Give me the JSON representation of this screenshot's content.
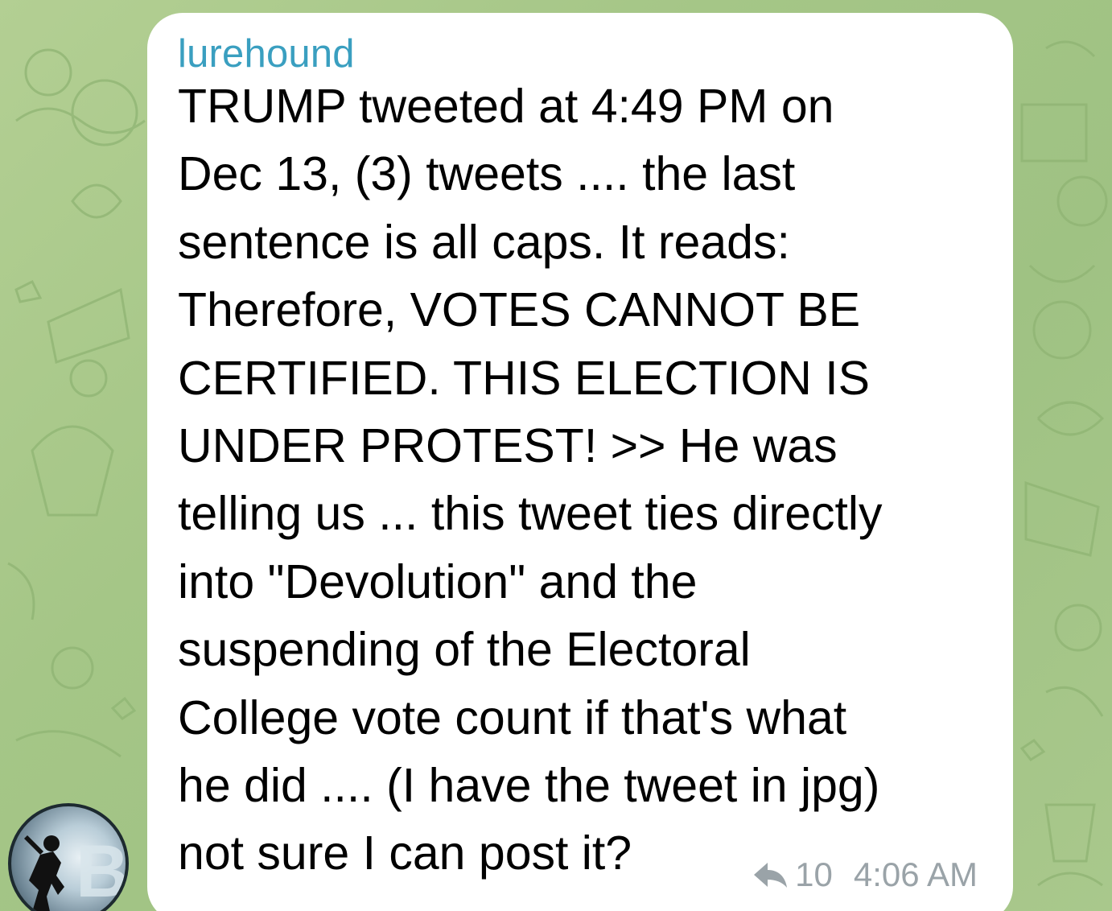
{
  "message": {
    "sender": "lurehound",
    "text": "TRUMP tweeted at 4:49 PM on\nDec 13, (3) tweets .... the last\nsentence is all caps. It reads:\nTherefore, VOTES CANNOT BE\nCERTIFIED. THIS ELECTION IS\nUNDER PROTEST! >> He was\ntelling us ... this tweet ties directly\ninto \"Devolution\" and the\nsuspending of the Electoral\nCollege vote count if that's what\nhe did .... (I have the tweet in jpg)\nnot sure I can post it?",
    "reply_count": "10",
    "time": "4:06 AM",
    "reply_icon": "reply-arrow-icon"
  },
  "avatar": {
    "icon": "bitcoin-avatar"
  },
  "colors": {
    "sender": "#3a9fc0",
    "meta": "#9aa3a8",
    "background": "#a9c98a",
    "bubble": "#ffffff"
  }
}
